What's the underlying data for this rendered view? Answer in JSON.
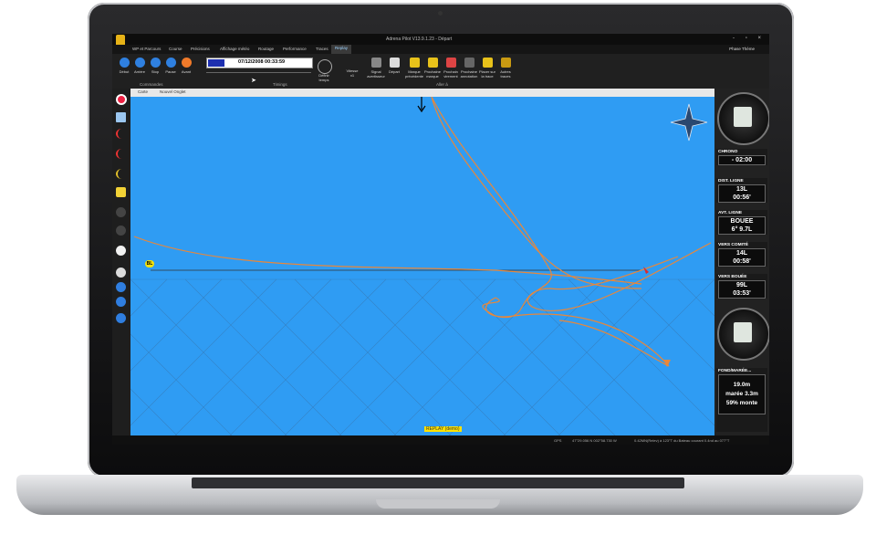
{
  "app": {
    "title": "Adrena Pilot V13.9.1.23 - Départ",
    "window_buttons": "- ▫ ×",
    "prefs": "Phase  Thème"
  },
  "tabs": [
    "WP et Parcours",
    "Course",
    "Précisions",
    "Affichage météo",
    "Routage",
    "Performance",
    "Traces",
    "Replay"
  ],
  "ribbon": {
    "commands": [
      "Début",
      "Arrière",
      "Stop",
      "Pause",
      "Avant"
    ],
    "datetime": "07/12/2008 00:33:59",
    "define_time": "Définir temps",
    "speed_label": "Vitesse",
    "speed_value": "x1",
    "goto": [
      "Signal avertisseur",
      "Départ",
      "Marque précédente",
      "Prochaine marque",
      "Prochain virement",
      "Prochaine annotation",
      "Placer sur la trace",
      "Autres traces"
    ],
    "group_commands": "Commandes",
    "group_timings": "Timings",
    "group_goto": "Aller à"
  },
  "doc_tabs": [
    "Carte",
    "Nouvel Onglet"
  ],
  "map": {
    "replay_label": "REPLAY (demo)",
    "mark_label": "BL"
  },
  "panel": {
    "blocks": [
      {
        "title": "CHRONO",
        "lines": [
          "- 02:00"
        ]
      },
      {
        "title": "DIST. LIGNE",
        "lines": [
          "13L",
          "00:56'"
        ]
      },
      {
        "title": "AVT. LIGNE",
        "lines": [
          "BOUEE",
          "6° 9.7L"
        ]
      },
      {
        "title": "VERS COMITÉ",
        "lines": [
          "14L",
          "00:58'"
        ]
      },
      {
        "title": "VERS BOUÉE",
        "lines": [
          "99L",
          "03:53'"
        ]
      },
      {
        "title": "FOND/MARÉE...",
        "lines": [
          "19.0m",
          "marée 3.3m",
          "59% monte"
        ]
      }
    ]
  },
  "status": {
    "gps": "GPS",
    "position": "47°29.056 N  002°58.730 W",
    "info": "0.42MN(Relev) à 123°T du Bateau    courant 0.4nd au 077°T"
  },
  "colors": {
    "sea": "#2f9cf3",
    "track": "#e8873a",
    "accent": "#e6b217"
  }
}
